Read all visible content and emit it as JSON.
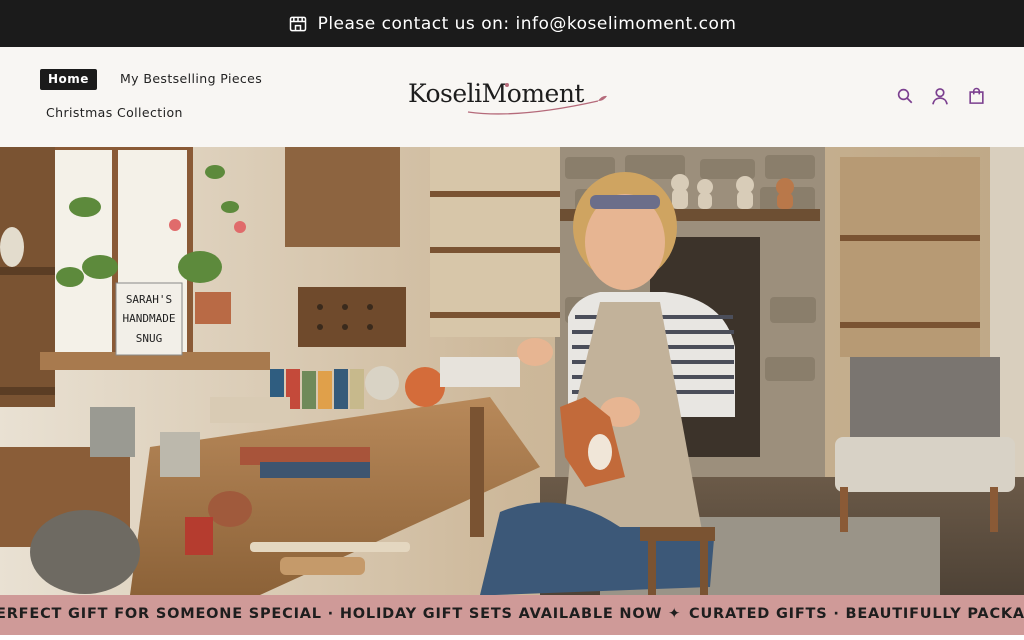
{
  "announcement": {
    "icon": "store-icon",
    "text": "Please contact us on: info@koselimoment.com"
  },
  "nav": {
    "items": [
      {
        "label": "Home",
        "active": true
      },
      {
        "label": "My Bestselling Pieces",
        "active": false
      },
      {
        "label": "Christmas Collection",
        "active": false
      }
    ]
  },
  "brand": {
    "logo_text": "KoseliMoment"
  },
  "header_icons": [
    "search-icon",
    "account-icon",
    "cart-icon"
  ],
  "hero": {
    "sign_lines": [
      "SARAH'S",
      "HANDMADE",
      "SNUG"
    ]
  },
  "marquee": {
    "text_1": "ERFECT GIFT FOR SOMEONE SPECIAL · HOLIDAY GIFT SETS AVAILABLE NOW ✦",
    "text_2": "CURATED GIFTS · BEAUTIFULLY PACKAGED"
  },
  "colors": {
    "topbar": "#1b1b1b",
    "header_bg": "#f8f6f3",
    "accent": "#7b3f8f",
    "marquee_bg": "#cf9a98"
  }
}
